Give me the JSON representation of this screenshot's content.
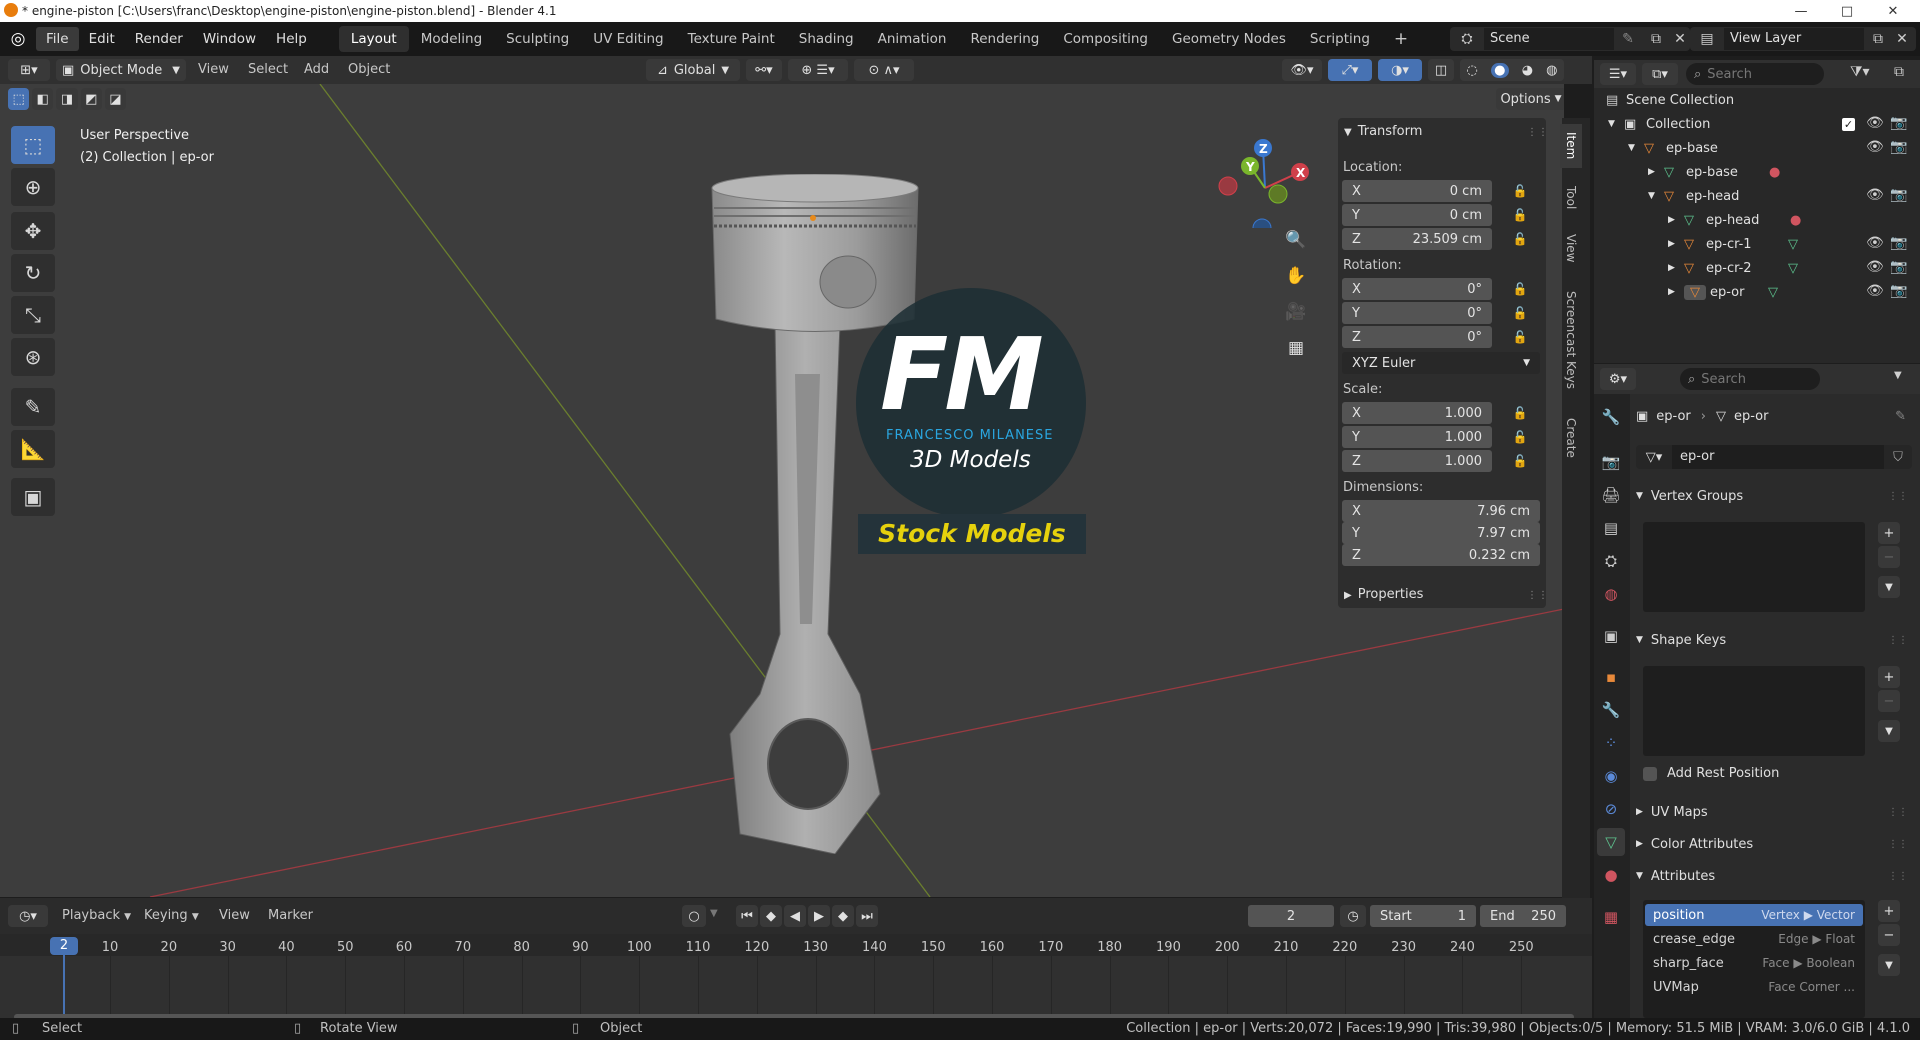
{
  "window": {
    "title": "* engine-piston [C:\\Users\\franc\\Desktop\\engine-piston\\engine-piston.blend] - Blender 4.1",
    "minimize": "—",
    "maximize": "□",
    "close": "✕"
  },
  "menubar": {
    "menus": [
      "File",
      "Edit",
      "Render",
      "Window",
      "Help"
    ],
    "workspaces": [
      "Layout",
      "Modeling",
      "Sculpting",
      "UV Editing",
      "Texture Paint",
      "Shading",
      "Animation",
      "Rendering",
      "Compositing",
      "Geometry Nodes",
      "Scripting"
    ],
    "active_workspace": "Layout",
    "add_workspace": "+",
    "scene_label": "Scene",
    "view_layer_label": "View Layer"
  },
  "viewport_header": {
    "mode": "Object Mode",
    "menus": [
      "View",
      "Select",
      "Add",
      "Object"
    ],
    "orientation": "Global",
    "options": "Options"
  },
  "viewport": {
    "perspective": "User Perspective",
    "context": "(2) Collection | ep-or",
    "watermark_initials": "FM",
    "watermark_name": "FRANCESCO MILANESE",
    "watermark_sub": "3D Models",
    "watermark_banner": "Stock Models",
    "gizmo": {
      "x": "X",
      "y": "Y",
      "z": "Z"
    }
  },
  "npanel": {
    "transform_title": "Transform",
    "location_label": "Location:",
    "location": [
      {
        "axis": "X",
        "value": "0 cm"
      },
      {
        "axis": "Y",
        "value": "0 cm"
      },
      {
        "axis": "Z",
        "value": "23.509 cm"
      }
    ],
    "rotation_label": "Rotation:",
    "rotation": [
      {
        "axis": "X",
        "value": "0°"
      },
      {
        "axis": "Y",
        "value": "0°"
      },
      {
        "axis": "Z",
        "value": "0°"
      }
    ],
    "rotation_mode": "XYZ Euler",
    "scale_label": "Scale:",
    "scale": [
      {
        "axis": "X",
        "value": "1.000"
      },
      {
        "axis": "Y",
        "value": "1.000"
      },
      {
        "axis": "Z",
        "value": "1.000"
      }
    ],
    "dimensions_label": "Dimensions:",
    "dimensions": [
      {
        "axis": "X",
        "value": "7.96 cm"
      },
      {
        "axis": "Y",
        "value": "7.97 cm"
      },
      {
        "axis": "Z",
        "value": "0.232 cm"
      }
    ],
    "properties_title": "Properties",
    "tabs": [
      "Item",
      "Tool",
      "View",
      "Screencast Keys",
      "Create"
    ]
  },
  "outliner": {
    "search_placeholder": "Search",
    "root": "Scene Collection",
    "items": [
      {
        "name": "Collection",
        "depth": 0
      },
      {
        "name": "ep-base",
        "depth": 1
      },
      {
        "name": "ep-base",
        "depth": 2
      },
      {
        "name": "ep-head",
        "depth": 2
      },
      {
        "name": "ep-head",
        "depth": 3
      },
      {
        "name": "ep-cr-1",
        "depth": 3
      },
      {
        "name": "ep-cr-2",
        "depth": 3
      },
      {
        "name": "ep-or",
        "depth": 3
      }
    ]
  },
  "properties": {
    "search_placeholder": "Search",
    "breadcrumb_object": "ep-or",
    "breadcrumb_data": "ep-or",
    "mesh_name": "ep-or",
    "sections": {
      "vertex_groups": "Vertex Groups",
      "shape_keys": "Shape Keys",
      "add_rest_position": "Add Rest Position",
      "uv_maps": "UV Maps",
      "color_attributes": "Color Attributes",
      "attributes": "Attributes"
    },
    "attributes": [
      {
        "name": "position",
        "domain": "Vertex",
        "type": "Vector"
      },
      {
        "name": "crease_edge",
        "domain": "Edge",
        "type": "Float"
      },
      {
        "name": "sharp_face",
        "domain": "Face",
        "type": "Boolean"
      },
      {
        "name": "UVMap",
        "domain": "Face Corner",
        "type": "..."
      }
    ],
    "plus": "+",
    "minus": "−"
  },
  "timeline": {
    "menus": [
      "Playback",
      "Keying",
      "View",
      "Marker"
    ],
    "current_frame": "2",
    "start_label": "Start",
    "start": "1",
    "end_label": "End",
    "end": "250",
    "ticks": [
      "10",
      "20",
      "30",
      "40",
      "50",
      "60",
      "70",
      "80",
      "90",
      "100",
      "110",
      "120",
      "130",
      "140",
      "150",
      "160",
      "170",
      "180",
      "190",
      "200",
      "210",
      "220",
      "230",
      "240",
      "250"
    ]
  },
  "statusbar": {
    "select": "Select",
    "rotate": "Rotate View",
    "object": "Object",
    "stats": "Collection | ep-or | Verts:20,072 | Faces:19,990 | Tris:39,980 | Objects:0/5 | Memory: 51.5 MiB | VRAM: 3.0/6.0 GiB | 4.1.0"
  }
}
